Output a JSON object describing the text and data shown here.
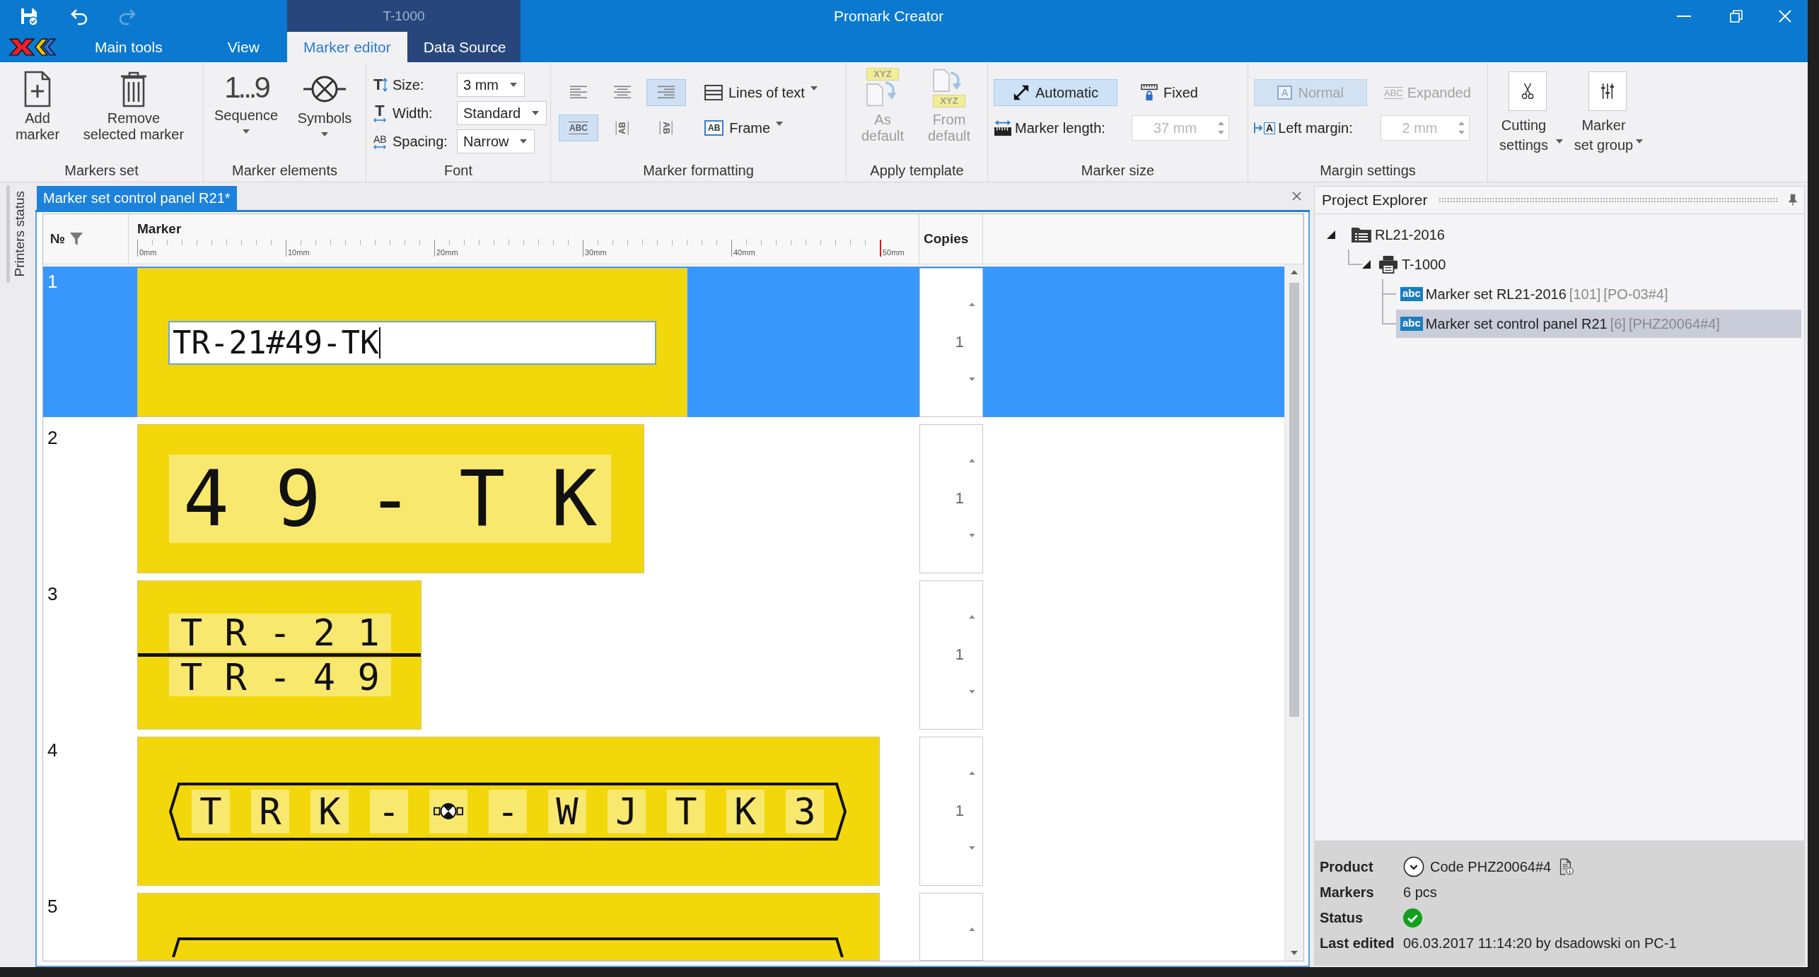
{
  "title_bar": {
    "title": "Promark Creator",
    "context_label": "T-1000"
  },
  "ribbon_tabs": [
    {
      "label": "Main tools",
      "selected": false,
      "contextual": false
    },
    {
      "label": "View",
      "selected": false,
      "contextual": false
    },
    {
      "label": "Marker editor",
      "selected": true,
      "contextual": true
    },
    {
      "label": "Data Source",
      "selected": false,
      "contextual": true
    }
  ],
  "ribbon": {
    "markers_set": {
      "title": "Markers set",
      "add": "Add marker",
      "remove": "Remove selected marker"
    },
    "marker_elements": {
      "title": "Marker elements",
      "sequence": {
        "label": "Sequence",
        "icon_text": "1...9"
      },
      "symbols": {
        "label": "Symbols"
      }
    },
    "font": {
      "title": "Font",
      "rows": [
        {
          "kind": "size",
          "icon_text": "T",
          "label": "Size:",
          "value": "3 mm"
        },
        {
          "kind": "width",
          "icon_text": "T",
          "label": "Width:",
          "value": "Standard"
        },
        {
          "kind": "spacing",
          "icon_text": "AB",
          "label": "Spacing:",
          "value": "Narrow"
        }
      ]
    },
    "marker_formatting": {
      "title": "Marker formatting",
      "alignment": [
        {
          "kind": "left",
          "selected": false
        },
        {
          "kind": "center",
          "selected": false
        },
        {
          "kind": "right",
          "selected": true
        }
      ],
      "orientation": [
        {
          "kind": "horizontal",
          "glyph": "ABC",
          "selected": true
        },
        {
          "kind": "rotated-left",
          "glyph": "AB",
          "selected": false
        },
        {
          "kind": "rotated-right",
          "glyph": "AB",
          "selected": false
        }
      ],
      "lines_of_text": "Lines of text",
      "frame": {
        "label": "Frame",
        "icon_text": "AB"
      }
    },
    "apply_template": {
      "title": "Apply template",
      "buttons": [
        {
          "kind": "as-default",
          "label": "As default",
          "icon_text": "XYZ",
          "disabled": true
        },
        {
          "kind": "from-default",
          "label": "From default",
          "icon_text": "XYZ",
          "disabled": true
        }
      ]
    },
    "marker_size": {
      "title": "Marker size",
      "modes": [
        {
          "kind": "automatic",
          "label": "Automatic",
          "selected": true,
          "disabled": false
        },
        {
          "kind": "fixed",
          "label": "Fixed",
          "selected": false,
          "disabled": false
        }
      ],
      "length": {
        "label": "Marker length:",
        "value": "37 mm",
        "disabled": true
      }
    },
    "margin_settings": {
      "title": "Margin settings",
      "modes": [
        {
          "kind": "normal",
          "label": "Normal",
          "icon_text": "A",
          "selected": true,
          "disabled": true
        },
        {
          "kind": "expanded",
          "label": "Expanded",
          "icon_text": "ABC",
          "selected": false,
          "disabled": true
        }
      ],
      "left_margin": {
        "label": "Left margin:",
        "icon_text": "A",
        "value": "2 mm",
        "disabled": true
      }
    },
    "settings": {
      "buttons": [
        {
          "kind": "cutting",
          "label": "Cutting settings"
        },
        {
          "kind": "group",
          "label": "Marker set group"
        }
      ]
    }
  },
  "side_panel": {
    "tab": "Printers status"
  },
  "document": {
    "tab": "Marker set control panel R21*",
    "columns": {
      "number": "№",
      "marker": "Marker",
      "copies": "Copies"
    },
    "ruler": [
      "0mm",
      "10mm",
      "20mm",
      "30mm",
      "40mm",
      "50mm"
    ],
    "rows": [
      {
        "number": "1",
        "selected": true,
        "kind": "editing",
        "text": "TR-21#49-TK",
        "copies": "1"
      },
      {
        "number": "2",
        "selected": false,
        "kind": "single",
        "text": "4 9 - T K",
        "copies": "1"
      },
      {
        "number": "3",
        "selected": false,
        "kind": "split",
        "lines": [
          "T R - 2 1",
          "T R - 4 9"
        ],
        "copies": "1"
      },
      {
        "number": "4",
        "selected": false,
        "kind": "framed",
        "cells": [
          {
            "kind": "char",
            "text": "T"
          },
          {
            "kind": "char",
            "text": "R"
          },
          {
            "kind": "char",
            "text": "K"
          },
          {
            "kind": "char",
            "text": "-"
          },
          {
            "kind": "symbol"
          },
          {
            "kind": "char",
            "text": "-"
          },
          {
            "kind": "char",
            "text": "W"
          },
          {
            "kind": "char",
            "text": "J"
          },
          {
            "kind": "char",
            "text": "T"
          },
          {
            "kind": "char",
            "text": "K"
          },
          {
            "kind": "char",
            "text": "3"
          }
        ],
        "copies": "1"
      },
      {
        "number": "5",
        "selected": false,
        "kind": "framed"
      }
    ]
  },
  "project_explorer": {
    "title": "Project Explorer",
    "tree": [
      {
        "label": "RL21-2016",
        "kind": "project",
        "expanded": true,
        "selected": false,
        "children": [
          {
            "label": "T-1000",
            "kind": "printer",
            "expanded": true,
            "selected": false,
            "children": [
              {
                "label": "Marker set RL21-2016",
                "kind": "marker-set",
                "badge": "abc",
                "count": "[101]",
                "code": "[PO-03#4]",
                "selected": false
              },
              {
                "label": "Marker set control panel R21",
                "kind": "marker-set",
                "badge": "abc",
                "count": "[6]",
                "code": "[PHZ20064#4]",
                "selected": true
              }
            ]
          }
        ]
      }
    ]
  },
  "details": [
    {
      "kind": "product",
      "label": "Product",
      "value": "Code PHZ20064#4"
    },
    {
      "kind": "text",
      "label": "Markers",
      "value": "6 pcs"
    },
    {
      "kind": "status",
      "label": "Status",
      "ok": true
    },
    {
      "kind": "text",
      "label": "Last edited",
      "value": "06.03.2017 11:14:20 by dsadowski on PC-1"
    }
  ]
}
